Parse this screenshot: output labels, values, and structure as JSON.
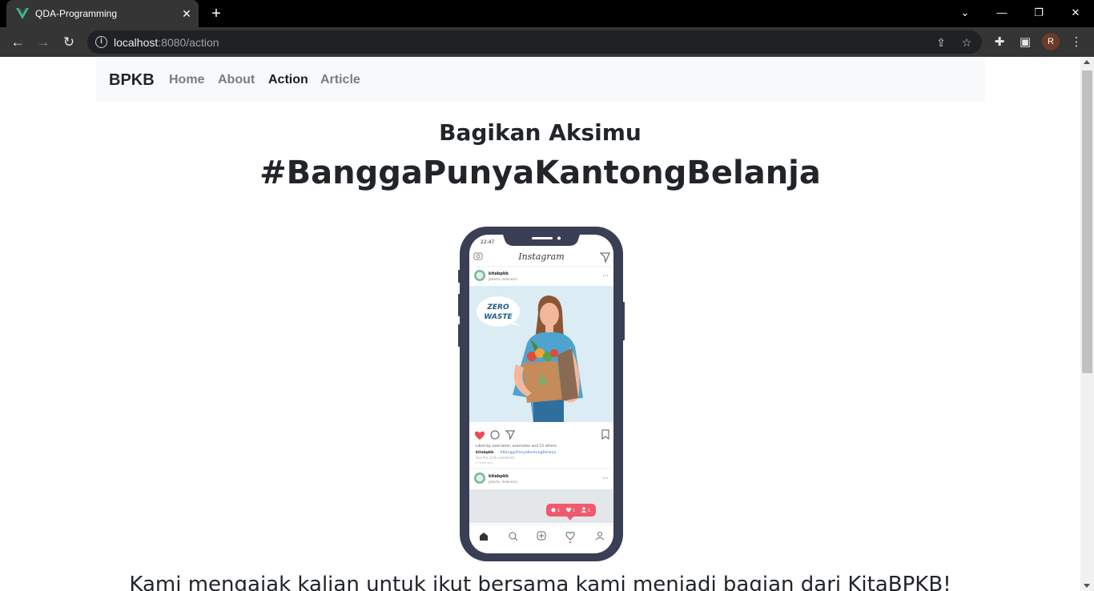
{
  "browser": {
    "tab_title": "QDA-Programming",
    "url_host": "localhost",
    "url_path": ":8080/action",
    "profile_initial": "R"
  },
  "navbar": {
    "brand": "BPKB",
    "links": [
      {
        "label": "Home",
        "active": false
      },
      {
        "label": "About",
        "active": false
      },
      {
        "label": "Action",
        "active": true
      },
      {
        "label": "Article",
        "active": false
      }
    ]
  },
  "hero": {
    "subtitle": "Bagikan Aksimu",
    "headline": "#BanggaPunyaKantongBelanja",
    "bottom_text": "Kami mengajak kalian untuk ikut bersama kami menjadi bagian dari KitaBPKB!"
  },
  "phone_mockup": {
    "time": "22:47",
    "app_title": "Instagram",
    "post_user": "kitabpkb",
    "post_location": "Jakarta, Indonesia",
    "speech_line1": "ZERO",
    "speech_line2": "WASTE",
    "liked_by": "Liked by username, username and 15 others",
    "caption_user": "kitabpkb",
    "caption_tag": "#BanggaPunyaKantongBelanja",
    "comments": "See the 123k comments",
    "time_ago": "2 hours ago",
    "second_user": "kitabpkb",
    "second_location": "Jakarta, Indonesia",
    "notif_comments": "1",
    "notif_likes": "1",
    "notif_follows": "1"
  },
  "colors": {
    "vue_green": "#41b883",
    "phone_frame": "#3a3f55",
    "heart": "#ed4956"
  }
}
